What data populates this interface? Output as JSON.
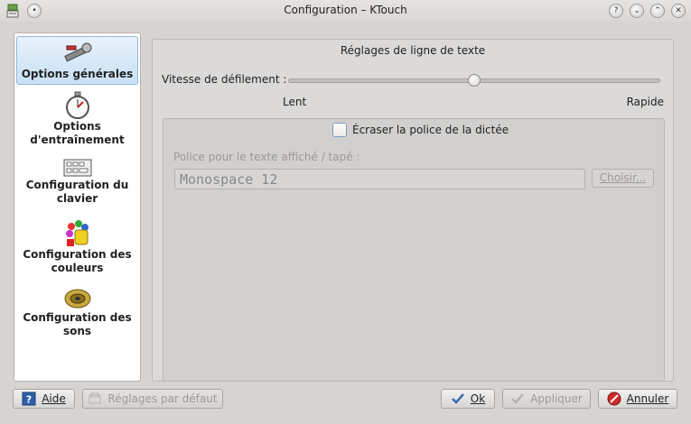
{
  "window": {
    "title": "Configuration – KTouch"
  },
  "titlebar_buttons": {
    "help": "?",
    "minimize": "⌄",
    "maximize": "⌃",
    "close": "✕",
    "menu": "•"
  },
  "sidebar": {
    "items": [
      {
        "label": "Options générales",
        "icon": "tools-icon",
        "selected": true
      },
      {
        "label": "Options d'entraînement",
        "icon": "stopwatch-icon",
        "selected": false
      },
      {
        "label": "Configuration du clavier",
        "icon": "keyboard-icon",
        "selected": false
      },
      {
        "label": "Configuration des couleurs",
        "icon": "paint-icon",
        "selected": false
      },
      {
        "label": "Configuration des sons",
        "icon": "speaker-icon",
        "selected": false
      }
    ]
  },
  "main": {
    "group_title": "Réglages de ligne de texte",
    "speed_label": "Vitesse de défilement :",
    "speed_value": 0.5,
    "speed_min_label": "Lent",
    "speed_max_label": "Rapide",
    "override_font_label": "Écraser la police de la dictée",
    "override_font_checked": false,
    "font_label": "Police pour le texte affiché / tapé :",
    "font_value": "Monospace 12",
    "choose_button": "Choisir..."
  },
  "buttons": {
    "help": "Aide",
    "defaults": "Réglages par défaut",
    "ok": "Ok",
    "apply": "Appliquer",
    "cancel": "Annuler"
  }
}
